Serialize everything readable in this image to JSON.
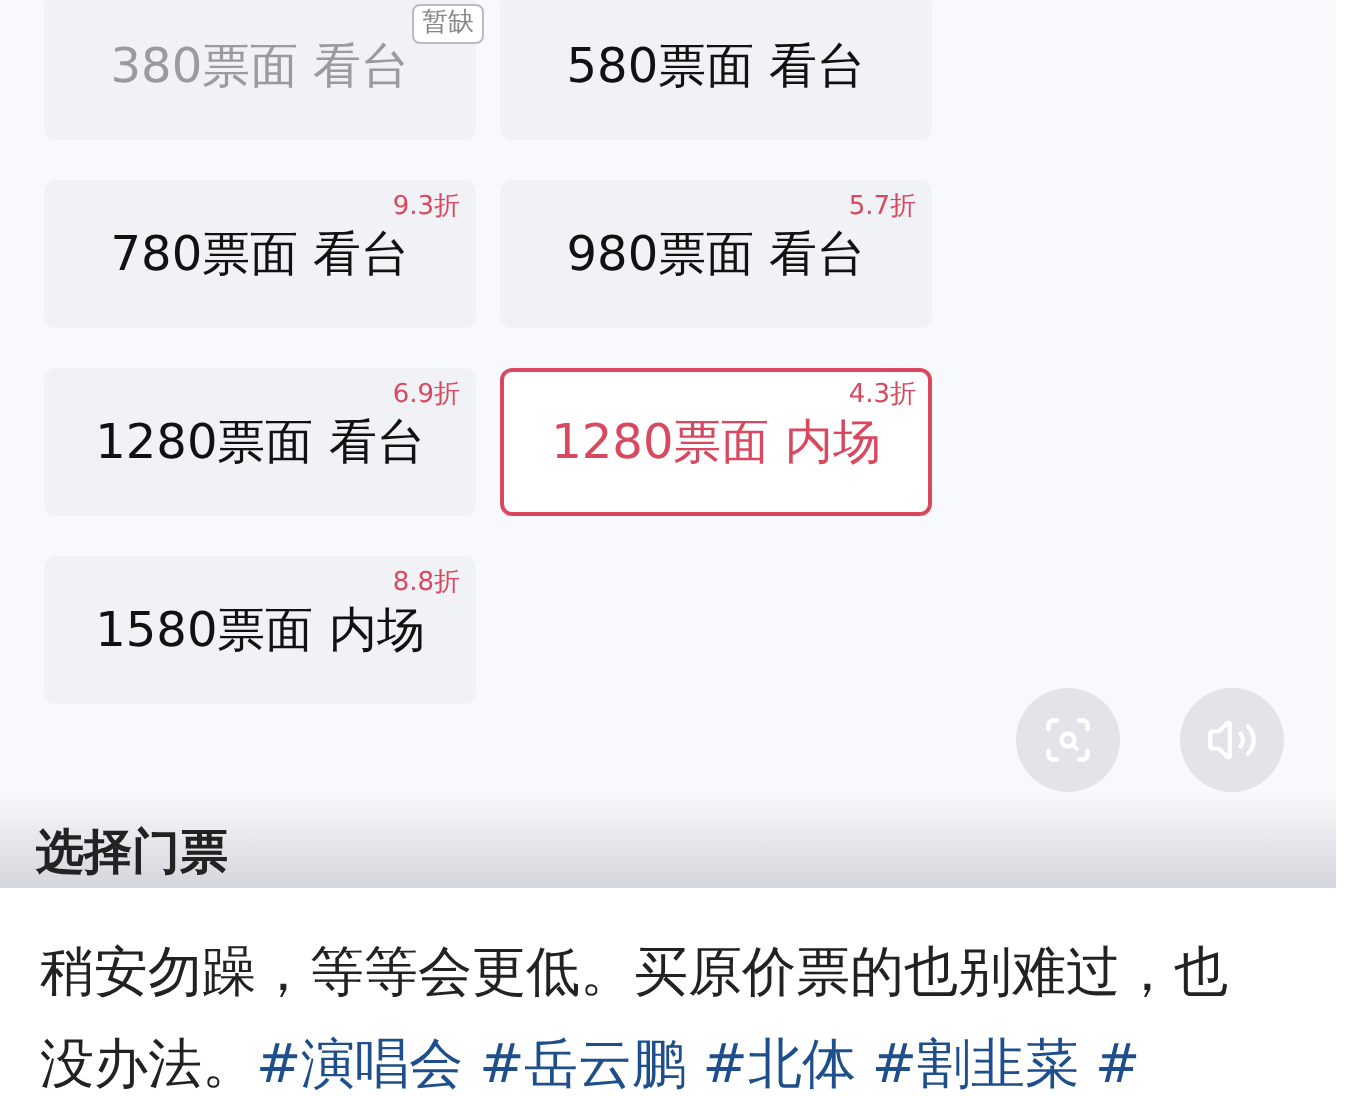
{
  "tickets": [
    {
      "label": "380票面 看台",
      "tag": "暂缺",
      "disabled": true,
      "selected": false
    },
    {
      "label": "580票面 看台",
      "disabled": false,
      "selected": false
    },
    {
      "label": "780票面 看台",
      "tag": "9.3折",
      "disabled": false,
      "selected": false
    },
    {
      "label": "980票面 看台",
      "tag": "5.7折",
      "disabled": false,
      "selected": false
    },
    {
      "label": "1280票面 看台",
      "tag": "6.9折",
      "disabled": false,
      "selected": false
    },
    {
      "label": "1280票面 内场",
      "tag": "4.3折",
      "disabled": false,
      "selected": true
    },
    {
      "label": "1580票面 内场",
      "tag": "8.8折",
      "disabled": false,
      "selected": false
    }
  ],
  "section_title": "选择门票",
  "post": {
    "text": "稍安勿躁，等等会更低。买原价票的也别难过，也没办法。",
    "hashtags": [
      "#演唱会",
      "#岳云鹏",
      "#北体",
      "#割韭菜",
      "#"
    ]
  }
}
